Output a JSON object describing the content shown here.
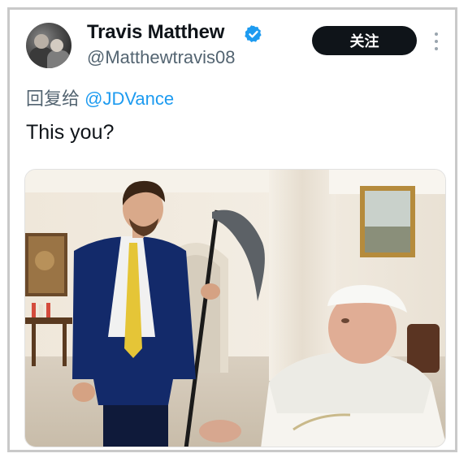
{
  "tweet": {
    "author_name": "Travis Matthew",
    "author_handle": "@Matthewtravis08",
    "verified": true,
    "follow_label": "关注",
    "reply_prefix": "回复给",
    "reply_mention": "@JDVance",
    "text": "This you?"
  },
  "icons": {
    "verified": "verified-badge-icon",
    "more": "more-vertical-icon",
    "avatar": "avatar"
  },
  "colors": {
    "follow_bg": "#0f1419",
    "mention": "#1d9bf0",
    "verified": "#1d9bf0",
    "secondary_text": "#536471"
  }
}
